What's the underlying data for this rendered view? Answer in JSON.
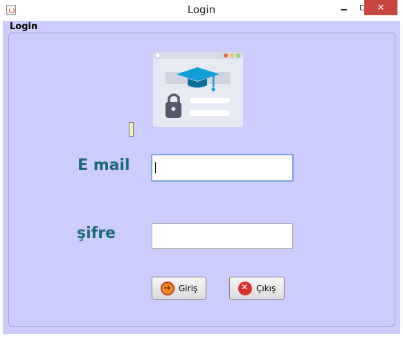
{
  "window": {
    "title": "Login",
    "controls": {
      "minimize": "minimize-icon",
      "maximize": "maximize-icon",
      "close": "close-icon"
    },
    "app_icon": "java-app-icon"
  },
  "panel": {
    "label": "Login"
  },
  "illustration": {
    "icon": "education-login-illustration"
  },
  "form": {
    "email_label": "E mail",
    "email_value": "",
    "password_label": "şifre",
    "password_value": ""
  },
  "buttons": {
    "login_label": "Giriş",
    "login_icon": "arrow-right-circle-icon",
    "exit_label": "Çıkış",
    "exit_icon": "close-circle-icon"
  },
  "colors": {
    "background": "#ccccff",
    "label_text": "#1a6a78",
    "close_button": "#c7463b"
  }
}
